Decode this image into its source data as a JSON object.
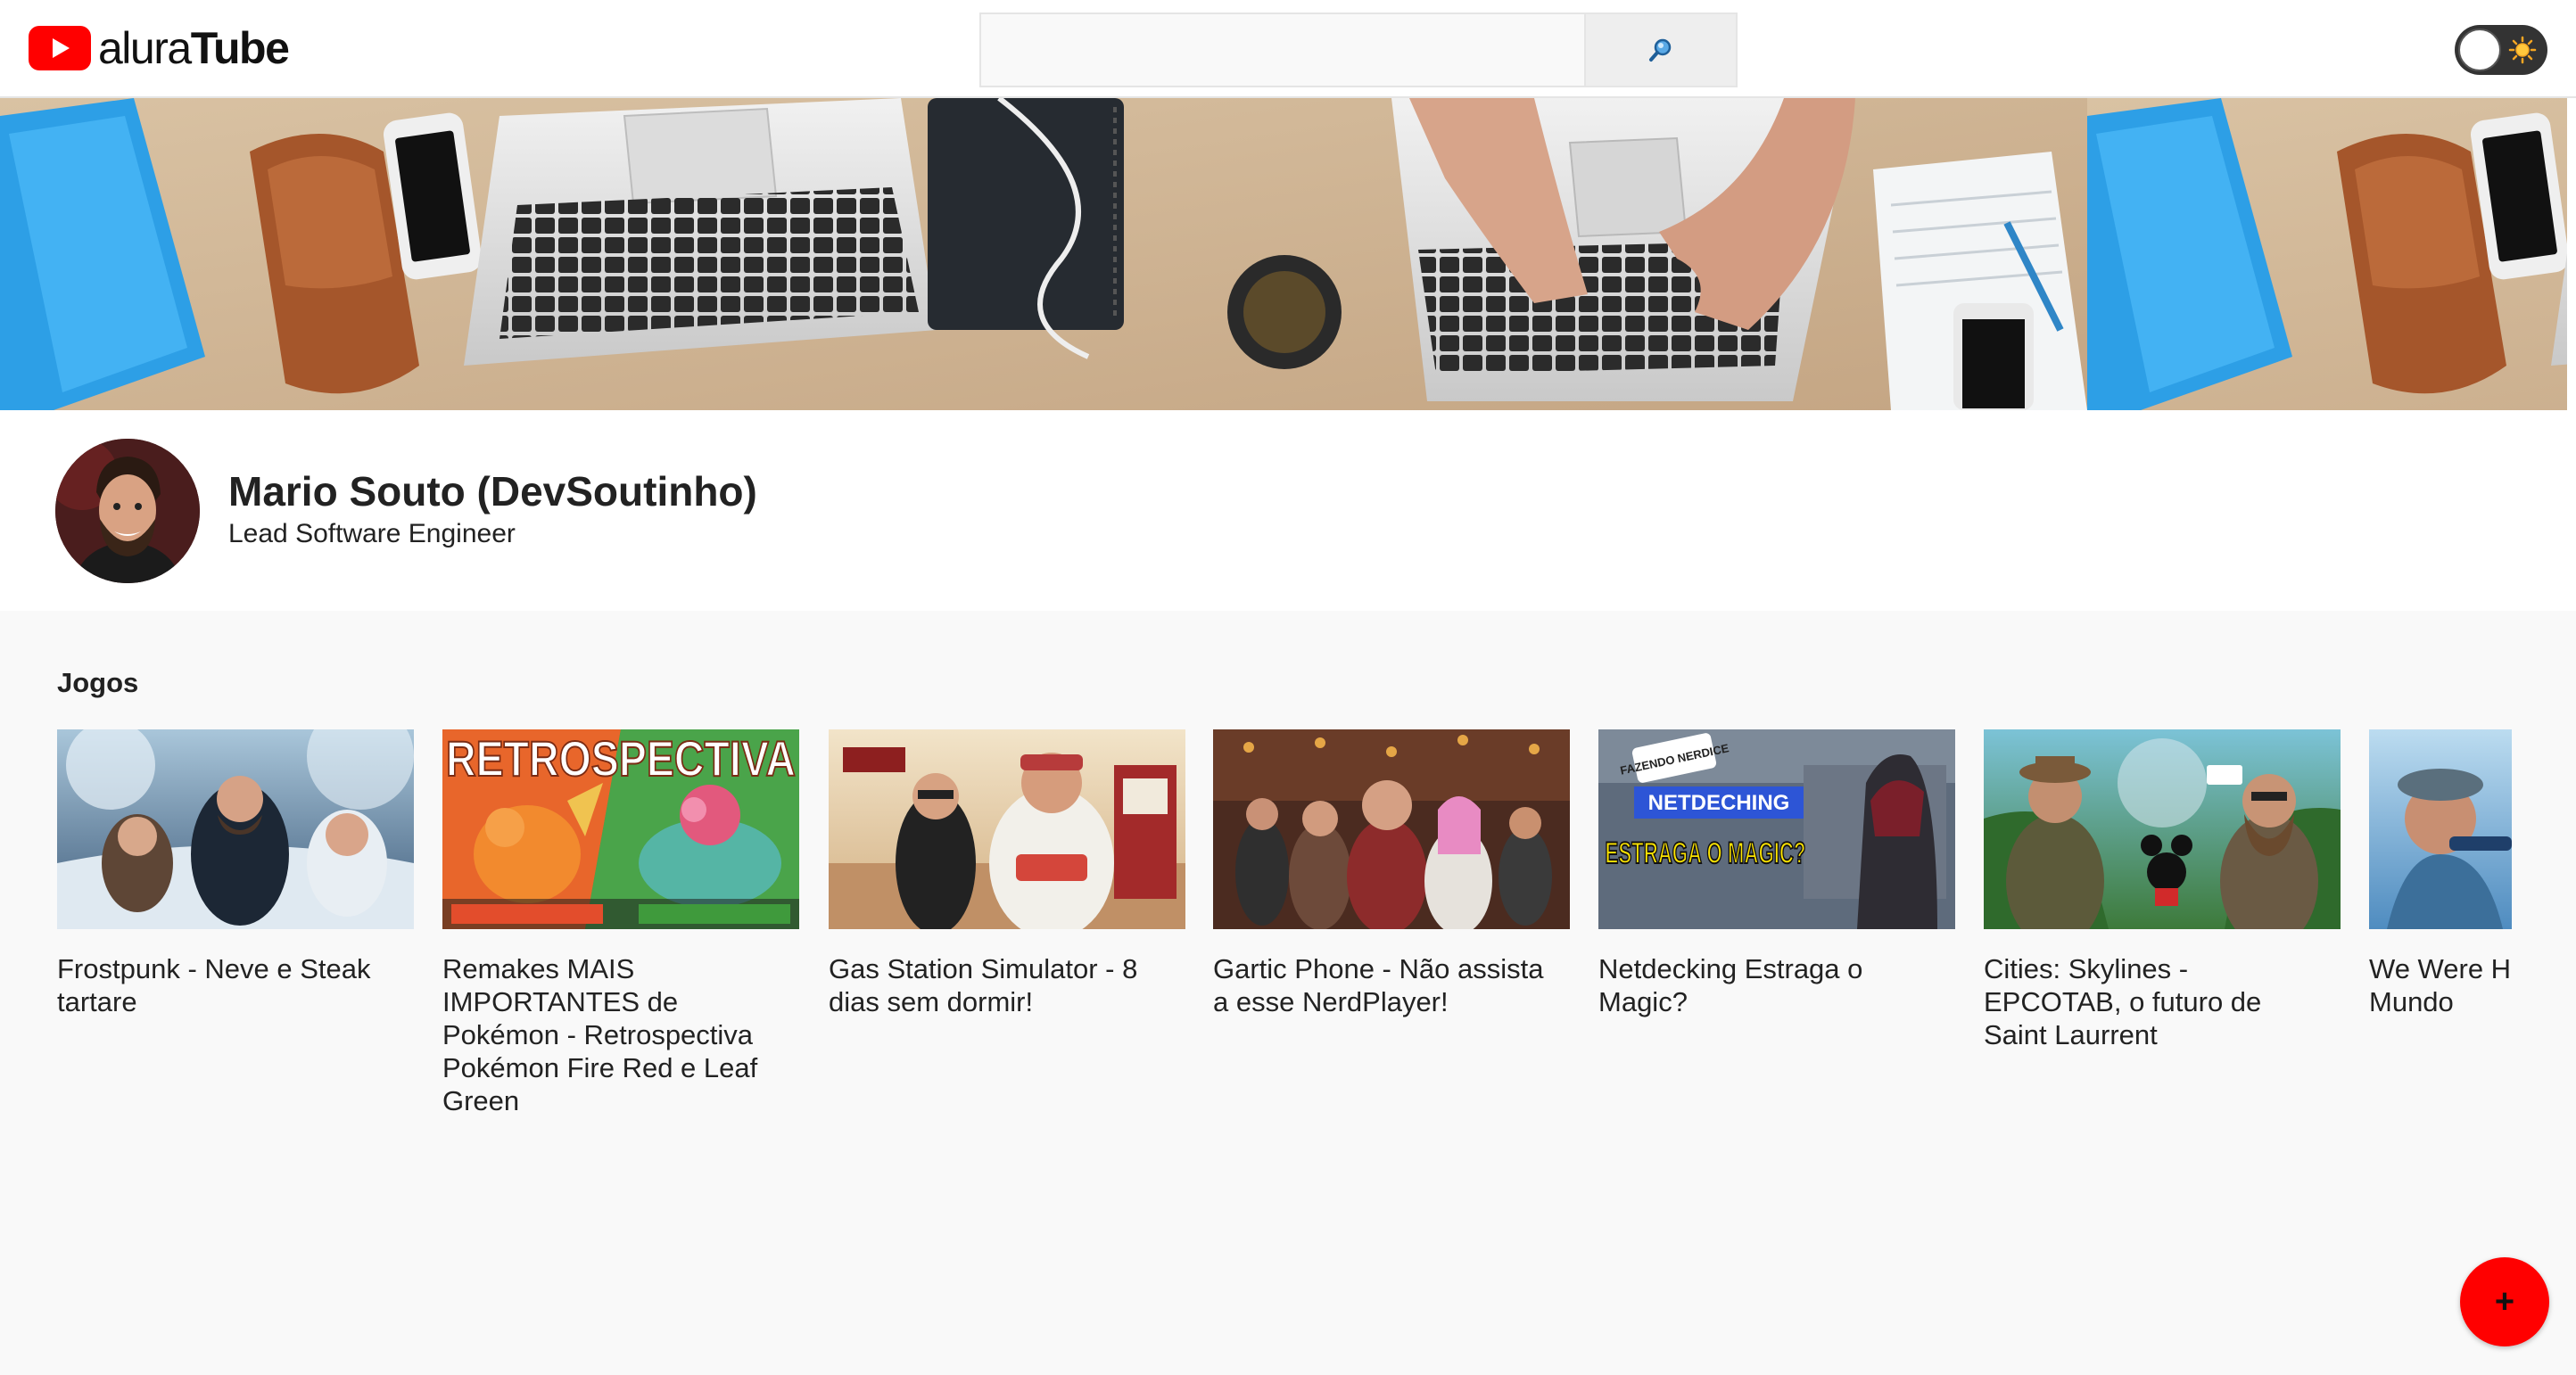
{
  "header": {
    "logo_text_light": "alura",
    "logo_text_bold": "Tube",
    "search": {
      "value": "",
      "placeholder": ""
    },
    "search_button_icon": "magnifier-icon",
    "theme_toggle_icon": "sun-icon"
  },
  "banner": {
    "image": "desk-laptops-photo"
  },
  "profile": {
    "name": "Mario Souto (DevSoutinho)",
    "role": "Lead Software Engineer"
  },
  "timeline": {
    "section_title": "Jogos",
    "videos": [
      {
        "title": "Frostpunk - Neve e Steak tartare"
      },
      {
        "title": "Remakes MAIS IMPORTANTES de Pokémon - Retrospectiva Pokémon Fire Red e Leaf Green",
        "thumb_text": "RETROSPECTIVA"
      },
      {
        "title": "Gas Station Simulator - 8 dias sem dormir!"
      },
      {
        "title": "Gartic Phone - Não assista a esse NerdPlayer!"
      },
      {
        "title": "Netdecking Estraga o Magic?",
        "thumb_text": [
          "FAZENDO NERDICE",
          "NETDECHING",
          "ESTRAGA O MAGIC?"
        ]
      },
      {
        "title": "Cities: Skylines - EPCOTAB, o futuro de Saint Laurrent"
      },
      {
        "title": "We Were H - Os Enigm Mundo"
      }
    ]
  },
  "fab": {
    "label": "+"
  },
  "colors": {
    "brand_red": "#ff0000",
    "header_bg": "#ffffff",
    "page_bg": "#f9f9f9",
    "text": "#222222"
  }
}
